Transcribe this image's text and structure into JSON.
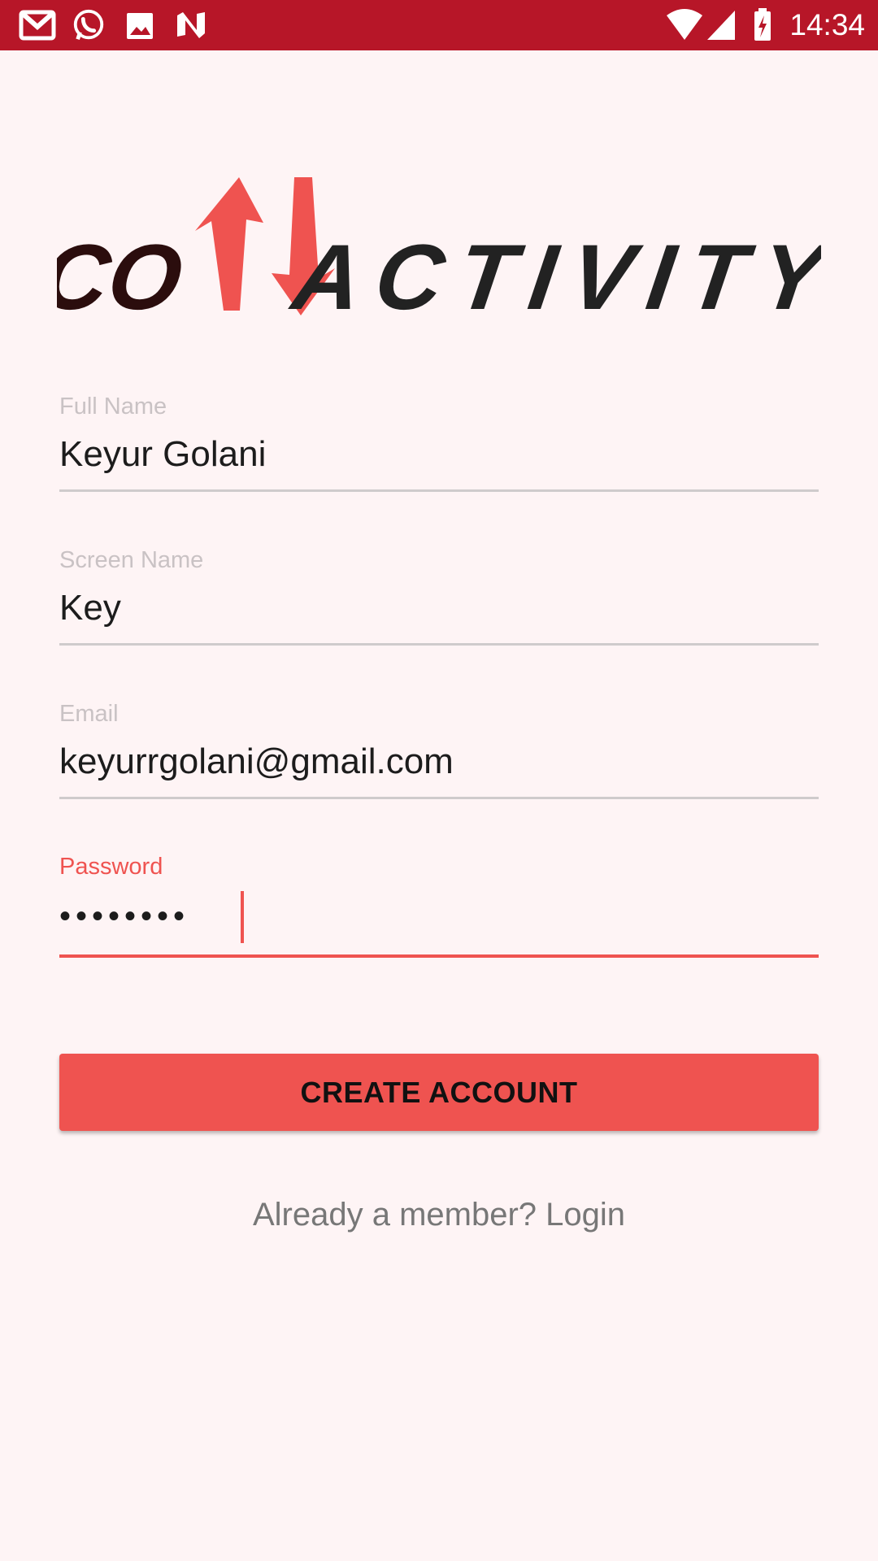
{
  "status_bar": {
    "time": "14:34",
    "left_icons": [
      "gmail-icon",
      "whatsapp-icon",
      "image-icon",
      "notification-n-icon"
    ],
    "right_icons": [
      "wifi-icon",
      "signal-icon",
      "battery-charging-icon"
    ],
    "color": "#b71628"
  },
  "logo": {
    "part1": "CO",
    "part2": "N",
    "part3": "ACTIVITY",
    "colors": {
      "dark": "#2b0d0d",
      "accent": "#ef5350",
      "gray": "#222222"
    }
  },
  "form": {
    "full_name": {
      "label": "Full Name",
      "value": "Keyur Golani"
    },
    "screen_name": {
      "label": "Screen Name",
      "value": "Key"
    },
    "email": {
      "label": "Email",
      "value": "keyurrgolani@gmail.com"
    },
    "password": {
      "label": "Password",
      "value": "••••••••"
    }
  },
  "create_button": {
    "label": "CREATE ACCOUNT"
  },
  "login_link": {
    "text": "Already a member? Login"
  },
  "colors": {
    "accent": "#ef5350",
    "background": "#fef4f5",
    "label_inactive": "#c9c2c4",
    "underline": "#cfcbcc"
  }
}
